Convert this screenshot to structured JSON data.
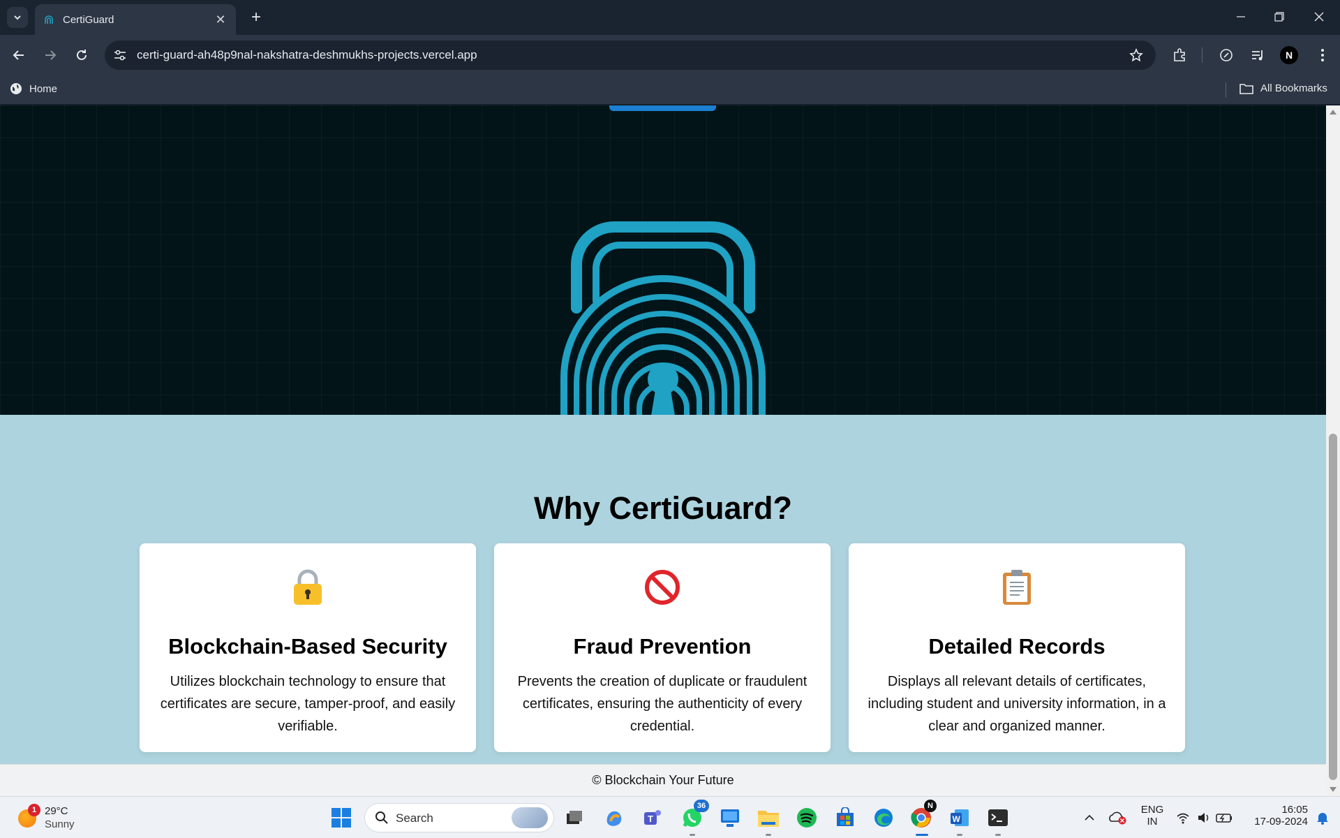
{
  "browser": {
    "tab_title": "CertiGuard",
    "url": "certi-guard-ah48p9nal-nakshatra-deshmukhs-projects.vercel.app",
    "bookmarks": {
      "home": "Home",
      "all": "All Bookmarks"
    },
    "profile_initial": "N"
  },
  "why": {
    "title": "Why CertiGuard?",
    "cards": [
      {
        "icon": "lock-icon",
        "title": "Blockchain-Based Security",
        "text": "Utilizes blockchain technology to ensure that certificates are secure, tamper-proof, and easily verifiable."
      },
      {
        "icon": "prohibited-icon",
        "title": "Fraud Prevention",
        "text": "Prevents the creation of duplicate or fraudulent certificates, ensuring the authenticity of every credential."
      },
      {
        "icon": "clipboard-icon",
        "title": "Detailed Records",
        "text": "Displays all relevant details of certificates, including student and university information, in a clear and organized manner."
      }
    ]
  },
  "footer": {
    "text": "© Blockchain Your Future"
  },
  "taskbar": {
    "weather": {
      "temp": "29°C",
      "desc": "Sunny",
      "badge": "1"
    },
    "search_placeholder": "Search",
    "whatsapp_badge": "36",
    "chrome_badge": "N",
    "lang": {
      "line1": "ENG",
      "line2": "IN"
    },
    "clock": {
      "time": "16:05",
      "date": "17-09-2024"
    }
  },
  "colors": {
    "hero_bg": "#031419",
    "why_bg": "#add3de",
    "accent_blue": "#1d7fd1",
    "lock_cyan": "#1fa2c4"
  }
}
